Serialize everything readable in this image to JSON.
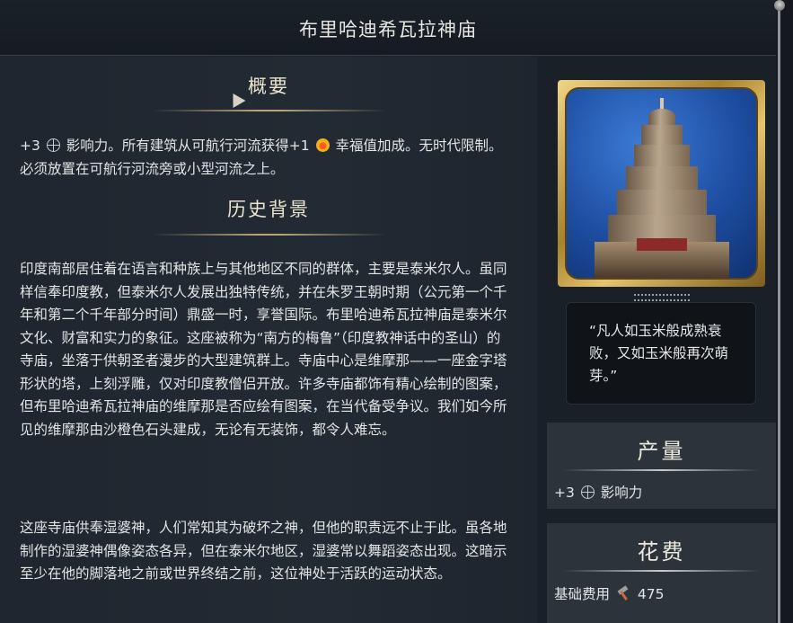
{
  "window": {
    "title": "布里哈迪希瓦拉神庙"
  },
  "overview": {
    "heading": "概要",
    "text_prefix": "+3",
    "influence_label": "影响力。所有建筑从可航行河流获得+1",
    "text_suffix": "幸福值加成。无时代限制。必须放置在可航行河流旁或小型河流之上。",
    "icons": [
      "globe-icon",
      "happy-face-icon"
    ]
  },
  "history": {
    "heading": "历史背景",
    "paragraphs": [
      "印度南部居住着在语言和种族上与其他地区不同的群体，主要是泰米尔人。虽同样信奉印度教，但泰米尔人发展出独特传统，并在朱罗王朝时期（公元第一个千年和第二个千年部分时间）鼎盛一时，享誉国际。布里哈迪希瓦拉神庙是泰米尔文化、财富和实力的象征。这座被称为“南方的梅鲁”（印度教神话中的圣山）的寺庙，坐落于供朝圣者漫步的大型建筑群上。寺庙中心是维摩那——一座金字塔形状的塔，上刻浮雕，仅对印度教僧侣开放。许多寺庙都饰有精心绘制的图案，但布里哈迪希瓦拉神庙的维摩那是否应绘有图案，在当代备受争议。我们如今所见的维摩那由沙橙色石头建成，无论有无装饰，都令人难忘。",
      "这座寺庙供奉湿婆神，人们常知其为破坏之神，但他的职责远不止于此。虽各地制作的湿婆神偶像姿态各异，但在泰米尔地区，湿婆常以舞蹈姿态出现。这暗示至少在他的脚落地之前或世界终结之前，这位神处于活跃的运动状态。"
    ]
  },
  "quote": {
    "text": "“凡人如玉米般成熟衰败，又如玉米般再次萌芽。”"
  },
  "yield": {
    "heading": "产量",
    "value": "+3",
    "label": "影响力"
  },
  "cost": {
    "heading": "花费",
    "label": "基础费用",
    "value": "475"
  },
  "colors": {
    "background": "#1c232c",
    "gold": "#b9a579",
    "panel": "#2c333b"
  }
}
